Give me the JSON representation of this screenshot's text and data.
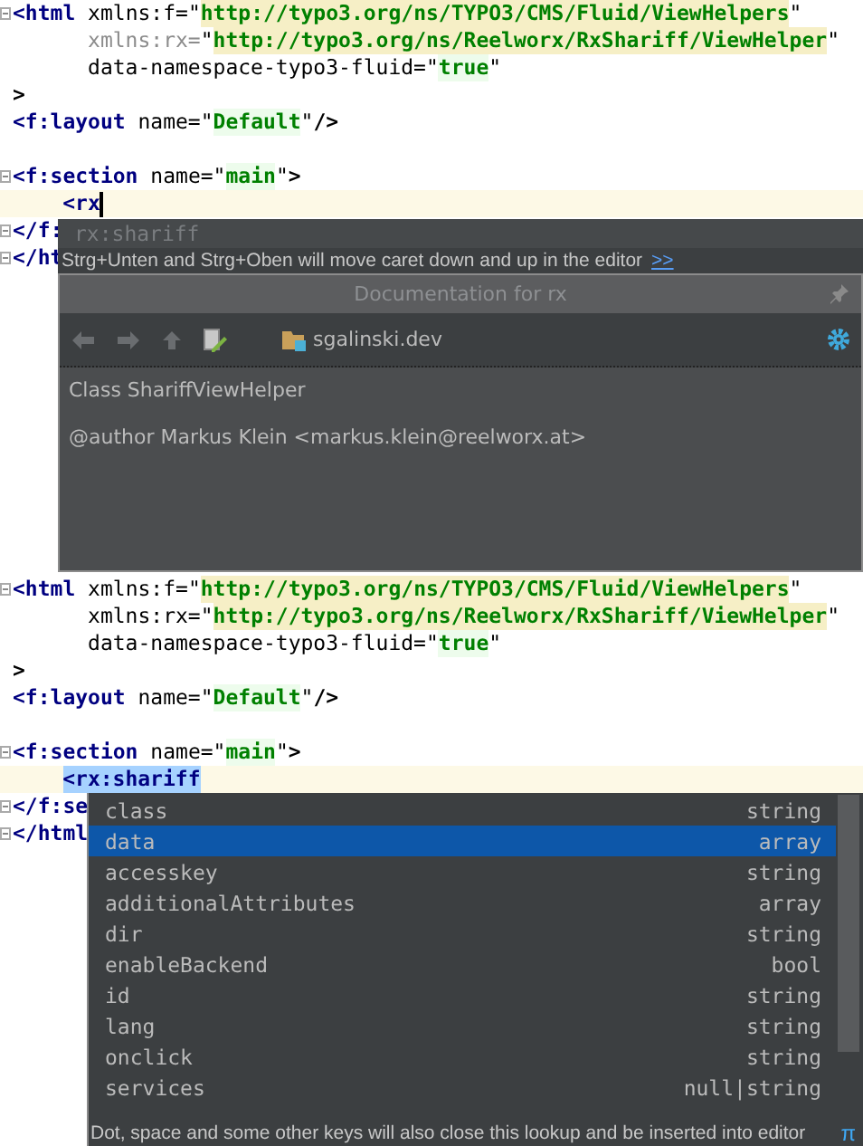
{
  "panels": [
    {
      "lines": [
        {
          "fold": true,
          "current": false,
          "cursor": false,
          "tokens": [
            {
              "kind": "tag",
              "text": "<html"
            },
            {
              "kind": "attr",
              "text": " xmlns:f="
            },
            {
              "kind": "quote",
              "text": "\""
            },
            {
              "kind": "url",
              "text": "http://typo3.org/ns/TYPO3/CMS/Fluid/ViewHelpers"
            },
            {
              "kind": "quote",
              "text": "\""
            }
          ]
        },
        {
          "fold": false,
          "current": false,
          "cursor": false,
          "tokens": [
            {
              "kind": "attr-unused",
              "text": "      xmlns:rx="
            },
            {
              "kind": "quote",
              "text": "\""
            },
            {
              "kind": "url",
              "text": "http://typo3.org/ns/Reelworx/RxShariff/ViewHelper"
            },
            {
              "kind": "quote",
              "text": "\""
            }
          ]
        },
        {
          "fold": false,
          "current": false,
          "cursor": false,
          "tokens": [
            {
              "kind": "attr",
              "text": "      data-namespace-typo3-fluid="
            },
            {
              "kind": "quote",
              "text": "\""
            },
            {
              "kind": "value",
              "text": "true"
            },
            {
              "kind": "quote",
              "text": "\""
            }
          ]
        },
        {
          "fold": false,
          "current": false,
          "cursor": false,
          "tokens": [
            {
              "kind": "punct",
              "text": ">"
            }
          ]
        },
        {
          "fold": false,
          "current": false,
          "cursor": false,
          "tokens": [
            {
              "kind": "tag",
              "text": "<f:layout"
            },
            {
              "kind": "attr",
              "text": " name="
            },
            {
              "kind": "quote",
              "text": "\""
            },
            {
              "kind": "value",
              "text": "Default"
            },
            {
              "kind": "quote",
              "text": "\""
            },
            {
              "kind": "punct",
              "text": "/>"
            }
          ]
        },
        {
          "fold": true,
          "current": false,
          "cursor": false,
          "blank_line_before": true,
          "tokens": [
            {
              "kind": "tag",
              "text": "<f:section"
            },
            {
              "kind": "attr",
              "text": " name="
            },
            {
              "kind": "quote",
              "text": "\""
            },
            {
              "kind": "value",
              "text": "main"
            },
            {
              "kind": "quote",
              "text": "\""
            },
            {
              "kind": "punct",
              "text": ">"
            }
          ]
        },
        {
          "fold": false,
          "current": true,
          "cursor": true,
          "indented": true,
          "tokens": [
            {
              "kind": "tag",
              "text": "<rx"
            }
          ]
        },
        {
          "fold": true,
          "current": false,
          "cursor": false,
          "tokens": [
            {
              "kind": "tag",
              "text": "</f:"
            }
          ]
        },
        {
          "fold": true,
          "current": false,
          "cursor": false,
          "tokens": [
            {
              "kind": "tag",
              "text": "</ht"
            }
          ]
        }
      ],
      "popup": {
        "kind": "documentation",
        "suggestion": "rx:shariff",
        "hint": "Strg+Unten and Strg+Oben will move caret down and up in the editor",
        "hint_link": ">>",
        "doc": {
          "title": "Documentation for rx",
          "location": "sgalinski.dev",
          "lines": [
            "Class ShariffViewHelper",
            "@author Markus Klein <markus.klein@reelworx.at>"
          ]
        }
      }
    },
    {
      "lines": [
        {
          "fold": true,
          "current": false,
          "cursor": false,
          "tokens": [
            {
              "kind": "tag",
              "text": "<html"
            },
            {
              "kind": "attr",
              "text": " xmlns:f="
            },
            {
              "kind": "quote",
              "text": "\""
            },
            {
              "kind": "url",
              "text": "http://typo3.org/ns/TYPO3/CMS/Fluid/ViewHelpers"
            },
            {
              "kind": "quote",
              "text": "\""
            }
          ]
        },
        {
          "fold": false,
          "current": false,
          "cursor": false,
          "tokens": [
            {
              "kind": "attr",
              "text": "      xmlns:rx="
            },
            {
              "kind": "quote",
              "text": "\""
            },
            {
              "kind": "url",
              "text": "http://typo3.org/ns/Reelworx/RxShariff/ViewHelper"
            },
            {
              "kind": "quote",
              "text": "\""
            }
          ]
        },
        {
          "fold": false,
          "current": false,
          "cursor": false,
          "tokens": [
            {
              "kind": "attr",
              "text": "      data-namespace-typo3-fluid="
            },
            {
              "kind": "quote",
              "text": "\""
            },
            {
              "kind": "value",
              "text": "true"
            },
            {
              "kind": "quote",
              "text": "\""
            }
          ]
        },
        {
          "fold": false,
          "current": false,
          "cursor": false,
          "tokens": [
            {
              "kind": "punct",
              "text": ">"
            }
          ]
        },
        {
          "fold": false,
          "current": false,
          "cursor": false,
          "tokens": [
            {
              "kind": "tag",
              "text": "<f:layout"
            },
            {
              "kind": "attr",
              "text": " name="
            },
            {
              "kind": "quote",
              "text": "\""
            },
            {
              "kind": "value",
              "text": "Default"
            },
            {
              "kind": "quote",
              "text": "\""
            },
            {
              "kind": "punct",
              "text": "/>"
            }
          ]
        },
        {
          "fold": true,
          "current": false,
          "cursor": false,
          "blank_line_before": true,
          "tokens": [
            {
              "kind": "tag",
              "text": "<f:section"
            },
            {
              "kind": "attr",
              "text": " name="
            },
            {
              "kind": "quote",
              "text": "\""
            },
            {
              "kind": "value",
              "text": "main"
            },
            {
              "kind": "quote",
              "text": "\""
            },
            {
              "kind": "punct",
              "text": ">"
            }
          ]
        },
        {
          "fold": false,
          "current": true,
          "cursor": false,
          "indented": true,
          "tokens": [
            {
              "kind": "selection",
              "text": "<rx:shariff"
            }
          ]
        },
        {
          "fold": true,
          "current": false,
          "cursor": false,
          "tokens": [
            {
              "kind": "tag",
              "text": "</f:se"
            }
          ]
        },
        {
          "fold": true,
          "current": false,
          "cursor": false,
          "tokens": [
            {
              "kind": "tag",
              "text": "</html"
            }
          ]
        }
      ],
      "popup": {
        "kind": "completion",
        "items": [
          {
            "name": "class",
            "type": "string",
            "selected": false
          },
          {
            "name": "data",
            "type": "array",
            "selected": true
          },
          {
            "name": "accesskey",
            "type": "string",
            "selected": false
          },
          {
            "name": "additionalAttributes",
            "type": "array",
            "selected": false
          },
          {
            "name": "dir",
            "type": "string",
            "selected": false
          },
          {
            "name": "enableBackend",
            "type": "bool",
            "selected": false
          },
          {
            "name": "id",
            "type": "string",
            "selected": false
          },
          {
            "name": "lang",
            "type": "string",
            "selected": false
          },
          {
            "name": "onclick",
            "type": "string",
            "selected": false
          },
          {
            "name": "services",
            "type": "null|string",
            "selected": false
          }
        ],
        "footer": "Dot, space and some other keys will also close this lookup and be inserted into editor",
        "footer_mark": "π"
      }
    }
  ]
}
